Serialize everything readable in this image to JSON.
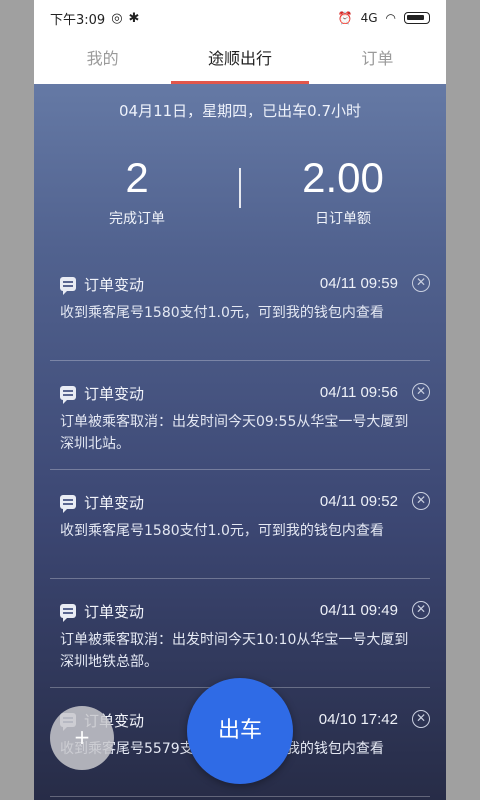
{
  "status_bar": {
    "time": "下午3:09",
    "signal_text": "4G"
  },
  "tabs": [
    {
      "label": "我的"
    },
    {
      "label": "途顺出行"
    },
    {
      "label": "订单"
    }
  ],
  "summary": {
    "date_line": "04月11日，星期四，已出车0.7小时",
    "completed_orders": {
      "value": "2",
      "label": "完成订单"
    },
    "daily_amount": {
      "value": "2.00",
      "label": "日订单额"
    }
  },
  "notifications": [
    {
      "title": "订单变动",
      "time": "04/11 09:59",
      "body": "收到乘客尾号1580支付1.0元，可到我的钱包内查看"
    },
    {
      "title": "订单变动",
      "time": "04/11 09:56",
      "body": "订单被乘客取消：出发时间今天09:55从华宝一号大厦到深圳北站。"
    },
    {
      "title": "订单变动",
      "time": "04/11 09:52",
      "body": "收到乘客尾号1580支付1.0元，可到我的钱包内查看"
    },
    {
      "title": "订单变动",
      "time": "04/11 09:49",
      "body": "订单被乘客取消：出发时间今天10:10从华宝一号大厦到深圳地铁总部。"
    },
    {
      "title": "订单变动",
      "time": "04/10 17:42",
      "body": "收到乘客尾号5579支付1.0元，可到我的钱包内查看"
    }
  ],
  "fab": {
    "add_label": "+",
    "go_label": "出车"
  }
}
